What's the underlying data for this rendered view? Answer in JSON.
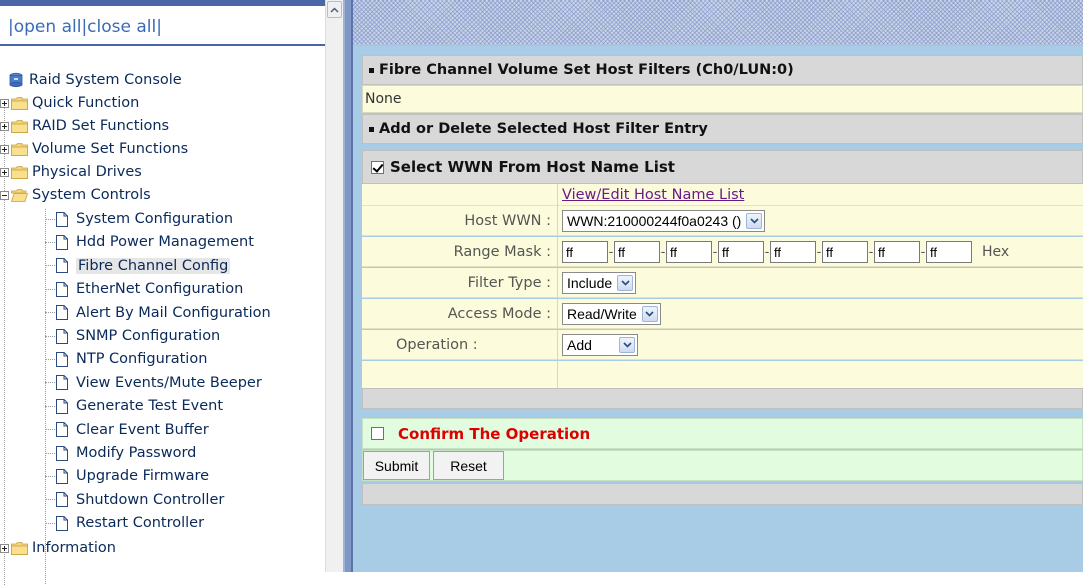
{
  "nav": {
    "open_all": "open all",
    "close_all": "close all",
    "sep1": "|",
    "sep2": "|",
    "sep3": "|",
    "root": "Raid System Console",
    "folders": [
      "Quick Function",
      "RAID Set Functions",
      "Volume Set Functions",
      "Physical Drives",
      "System Controls"
    ],
    "system_controls_items": [
      "System Configuration",
      "Hdd Power Management",
      "Fibre Channel Config",
      "EtherNet Configuration",
      "Alert By Mail Configuration",
      "SNMP Configuration",
      "NTP Configuration",
      "View Events/Mute Beeper",
      "Generate Test Event",
      "Clear Event Buffer",
      "Modify Password",
      "Upgrade Firmware",
      "Shutdown Controller",
      "Restart Controller"
    ],
    "selected_item": "Fibre Channel Config",
    "last_folder": "Information"
  },
  "main": {
    "filters_header": "Fibre Channel Volume Set Host Filters (Ch0/LUN:0)",
    "filters_value": "None",
    "add_delete_header": "Add or Delete Selected Host Filter Entry",
    "select_wwn_label": "Select WWN From Host Name List",
    "select_wwn_checked": true,
    "host_list_link": "View/Edit Host Name List",
    "host_wwn_label": "Host WWN :",
    "host_wwn_value": "WWN:210000244f0a0243 ()",
    "range_mask_label": "Range Mask :",
    "range_mask_values": [
      "ff",
      "ff",
      "ff",
      "ff",
      "ff",
      "ff",
      "ff",
      "ff"
    ],
    "range_mask_sep": "-",
    "range_mask_unit": "Hex",
    "filter_type_label": "Filter Type :",
    "filter_type_value": "Include",
    "access_mode_label": "Access Mode :",
    "access_mode_value": "Read/Write",
    "operation_label": "Operation :",
    "operation_value": "Add",
    "confirm_label": "Confirm The Operation",
    "confirm_checked": false,
    "submit_label": "Submit",
    "reset_label": "Reset"
  },
  "colors": {
    "nav_text": "#0a2a5a",
    "open_close_link": "#3a6ab8",
    "confirm_text": "#dd0000",
    "header_gray": "#d8d8d8",
    "form_yellow": "#fcfcdc",
    "confirm_green": "#e2fce0",
    "right_bg": "#a9cce6"
  }
}
